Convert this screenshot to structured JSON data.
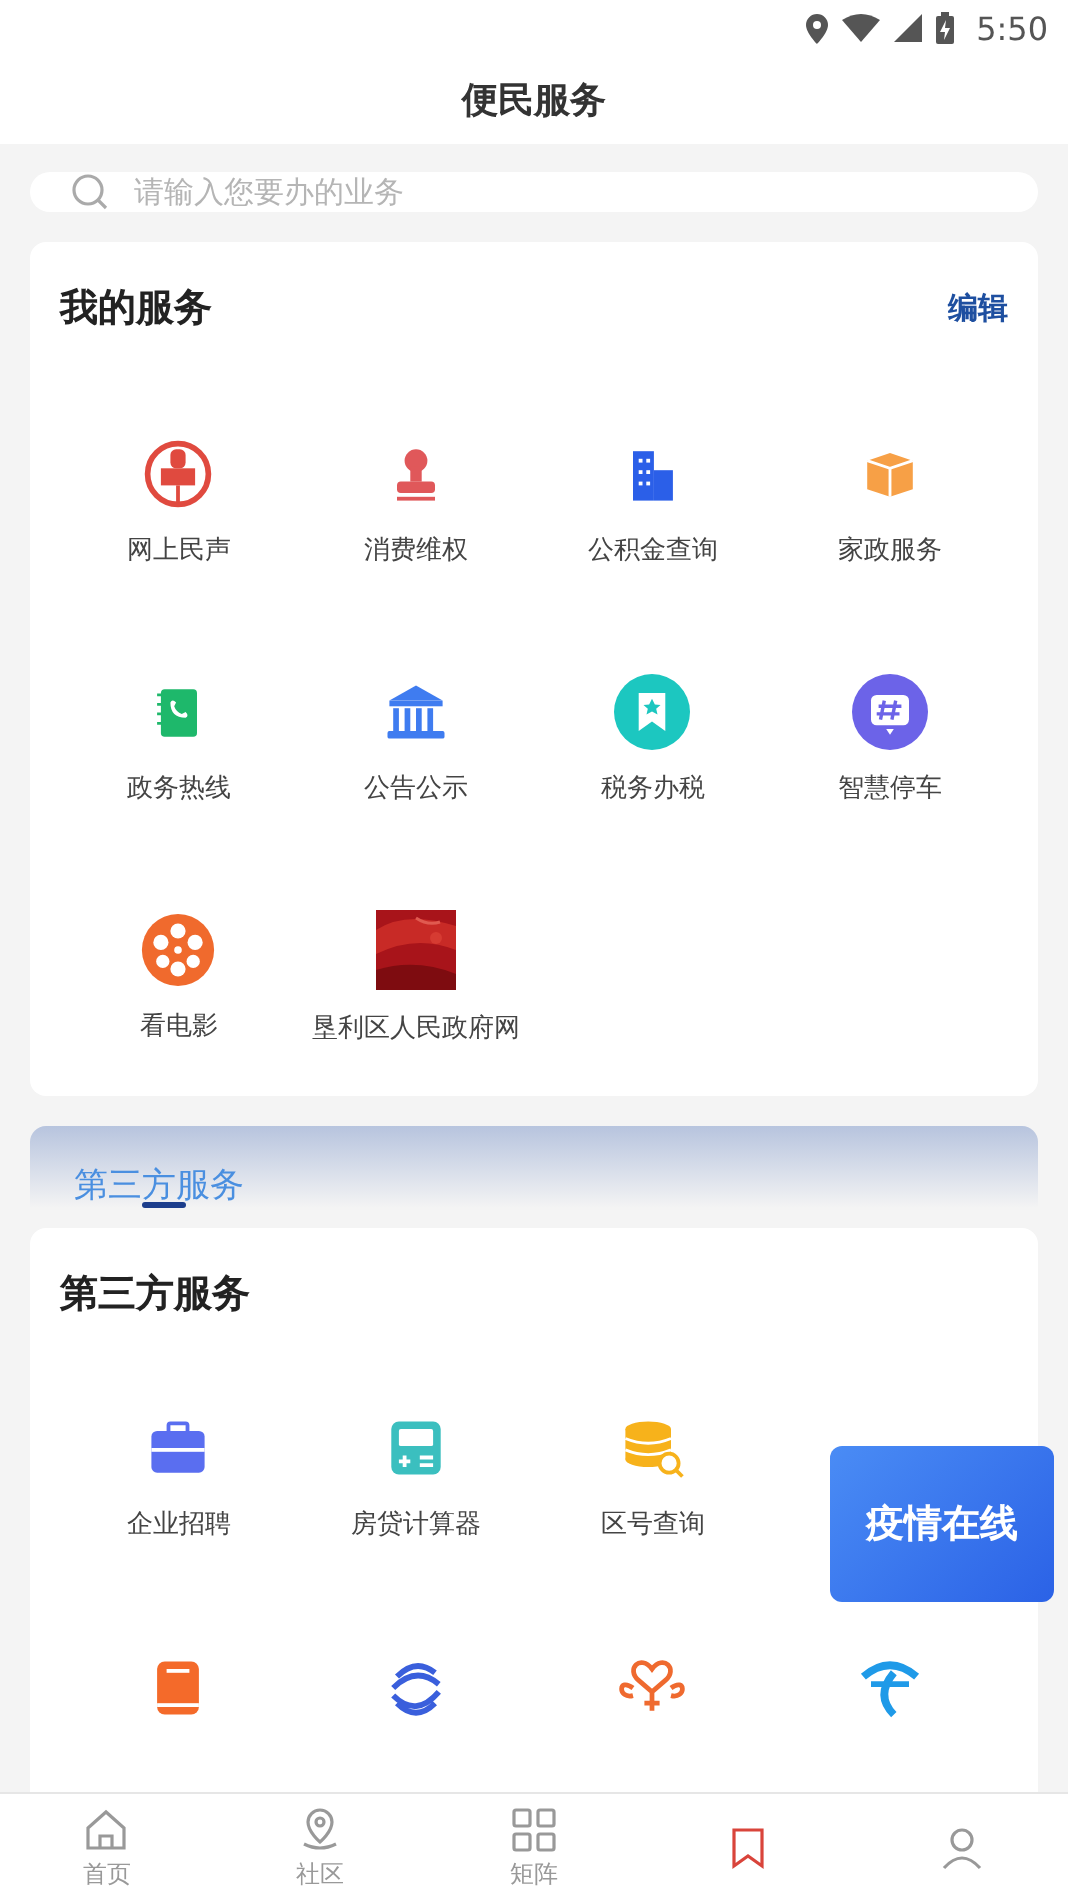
{
  "status_bar": {
    "time": "5:50"
  },
  "header": {
    "title": "便民服务"
  },
  "search": {
    "placeholder": "请输入您要办的业务"
  },
  "my_services": {
    "title": "我的服务",
    "action": "编辑",
    "items": [
      {
        "label": "网上民声"
      },
      {
        "label": "消费维权"
      },
      {
        "label": "公积金查询"
      },
      {
        "label": "家政服务"
      },
      {
        "label": "政务热线"
      },
      {
        "label": "公告公示"
      },
      {
        "label": "税务办税"
      },
      {
        "label": "智慧停车"
      },
      {
        "label": "看电影"
      },
      {
        "label": "垦利区人民政府网",
        "kind": "picture"
      }
    ]
  },
  "third_party_tabs": [
    {
      "label": "第三方服务",
      "selected": true
    }
  ],
  "third_party": {
    "title": "第三方服务",
    "items": [
      {
        "label": "企业招聘"
      },
      {
        "label": "房贷计算器"
      },
      {
        "label": "区号查询"
      },
      {
        "kind": "covered"
      },
      {
        "kind": "cut_off"
      },
      {
        "kind": "cut_off"
      },
      {
        "kind": "cut_off"
      },
      {
        "kind": "cut_off"
      }
    ]
  },
  "floating_banner": {
    "text": "疫情在线"
  },
  "bottom_nav": [
    {
      "label": "首页",
      "selected": false
    },
    {
      "label": "社区",
      "selected": false
    },
    {
      "label": "矩阵",
      "selected": false
    },
    {
      "selected": true
    },
    {
      "selected": false
    }
  ]
}
